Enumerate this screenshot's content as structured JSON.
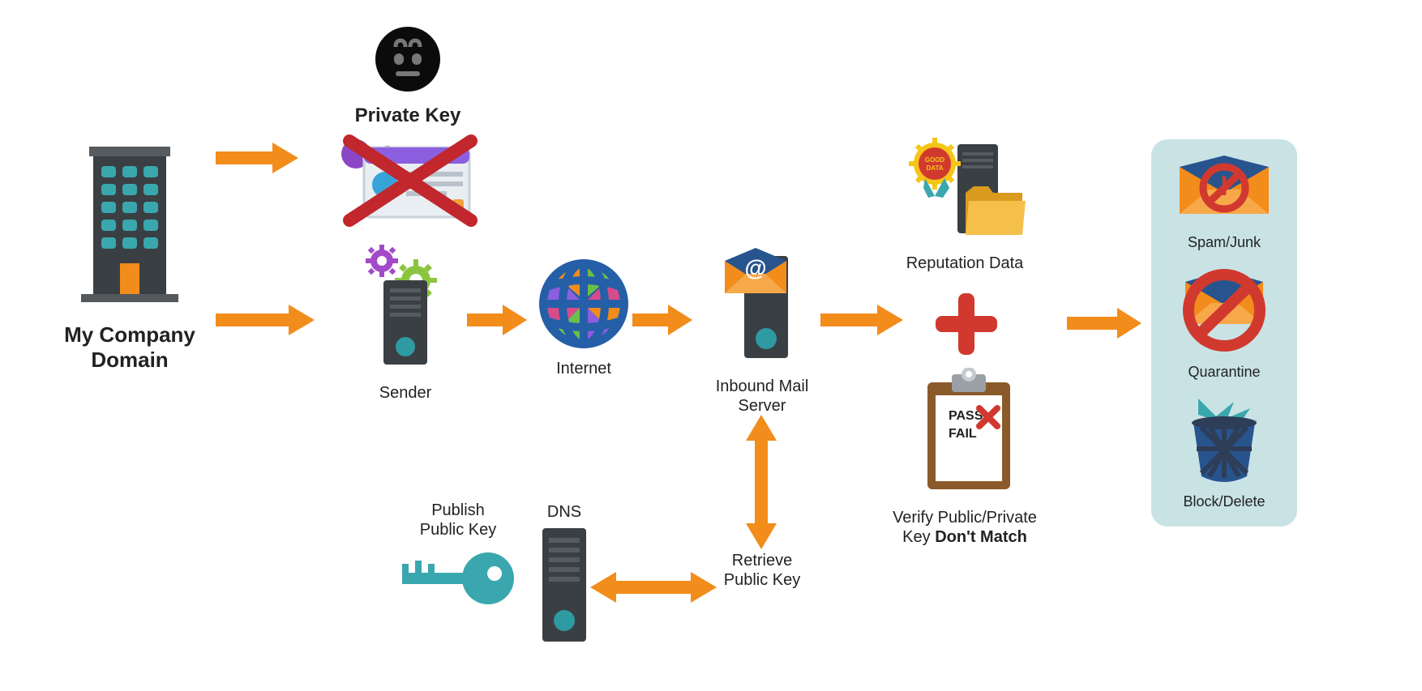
{
  "nodes": {
    "company": {
      "label": "My Company Domain"
    },
    "private_key": {
      "label": "Private Key"
    },
    "sender": {
      "label": "Sender"
    },
    "internet": {
      "label": "Internet"
    },
    "inbound": {
      "label": "Inbound Mail Server"
    },
    "reputation": {
      "label": "Reputation Data",
      "badge": "GOOD DATA"
    },
    "verify": {
      "label_prefix": "Verify Public/Private Key ",
      "label_bold": "Don't Match",
      "pass": "PASS",
      "fail": "FAIL"
    },
    "dns": {
      "label": "DNS"
    },
    "publish": {
      "label": "Publish Public Key"
    },
    "retrieve": {
      "label": "Retrieve Public Key"
    }
  },
  "outcomes": {
    "spam": {
      "label": "Spam/Junk"
    },
    "quarantine": {
      "label": "Quarantine"
    },
    "block": {
      "label": "Block/Delete"
    }
  }
}
